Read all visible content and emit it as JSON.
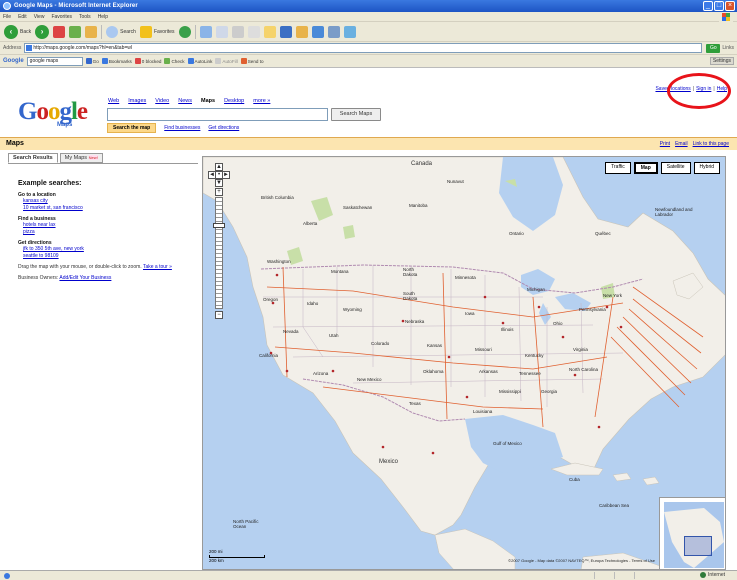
{
  "window": {
    "title": "Google Maps - Microsoft Internet Explorer"
  },
  "menubar": [
    "File",
    "Edit",
    "View",
    "Favorites",
    "Tools",
    "Help"
  ],
  "toolbar": {
    "back_label": "Back",
    "search_label": "Search",
    "favorites_label": "Favorites"
  },
  "address": {
    "label": "Address",
    "url": "http://maps.google.com/maps?hl=en&tab=wl",
    "go_label": "Go",
    "links_label": "Links"
  },
  "google_toolbar": {
    "brand": "Google",
    "query": "google maps",
    "items": [
      "Go",
      "Bookmarks",
      "0 blocked",
      "Check",
      "AutoLink",
      "AutoFill",
      "Send to",
      "Settings"
    ]
  },
  "header": {
    "links": [
      "Saved locations",
      "Sign in",
      "Help"
    ],
    "logo_letters": [
      "G",
      "o",
      "o",
      "g",
      "l",
      "e"
    ],
    "logo_sub": "Maps",
    "nav": [
      {
        "label": "Web",
        "active": false
      },
      {
        "label": "Images",
        "active": false
      },
      {
        "label": "Video",
        "active": false
      },
      {
        "label": "News",
        "active": false
      },
      {
        "label": "Maps",
        "active": true
      },
      {
        "label": "Desktop",
        "active": false
      },
      {
        "label": "more »",
        "active": false
      }
    ],
    "search_button": "Search Maps",
    "subtabs": [
      "Search the map",
      "Find businesses",
      "Get directions"
    ]
  },
  "maps_bar": {
    "title": "Maps",
    "actions": [
      "Print",
      "Email",
      "Link to this page"
    ]
  },
  "side": {
    "tabs": [
      "Search Results",
      "My Maps"
    ],
    "new_badge": "New!",
    "heading": "Example searches:",
    "sections": [
      {
        "title": "Go to a location",
        "links": [
          "kansas city",
          "10 market st, san francisco"
        ]
      },
      {
        "title": "Find a business",
        "links": [
          "hotels near lax",
          "pizza"
        ]
      },
      {
        "title": "Get directions",
        "links": [
          "jfk to 350 5th ave, new york",
          "seattle to 98109"
        ]
      }
    ],
    "drag_text": "Drag the map with your mouse, or double-click to zoom.",
    "tour_link": "Take a tour »",
    "owners_prefix": "Business Owners:",
    "owners_link": "Add/Edit Your Business"
  },
  "map": {
    "types": [
      {
        "label": "Traffic",
        "active": false
      },
      {
        "label": "Map",
        "active": true
      },
      {
        "label": "Satellite",
        "active": false
      },
      {
        "label": "Hybrid",
        "active": false
      }
    ],
    "scale": [
      "200 mi",
      "200 km"
    ],
    "copyright": "©2007 Google - Map data ©2007 NAVTEQ™, Europa Technologies - Terms of Use",
    "labels": {
      "canada": "Canada",
      "nunavut": "Nunavut",
      "bc": "British Columbia",
      "alberta": "Alberta",
      "saskatchewan": "Saskatchewan",
      "manitoba": "Manitoba",
      "ontario": "Ontario",
      "quebec": "Québec",
      "washington": "Washington",
      "oregon": "Oregon",
      "idaho": "Idaho",
      "montana": "Montana",
      "wyoming": "Wyoming",
      "north_dakota": "North Dakota",
      "south_dakota": "South Dakota",
      "minnesota": "Minnesota",
      "iowa": "Iowa",
      "nebraska": "Nebraska",
      "kansas": "Kansas",
      "missouri": "Missouri",
      "illinois": "Illinois",
      "colorado": "Colorado",
      "utah": "Utah",
      "nevada": "Nevada",
      "california": "California",
      "arizona": "Arizona",
      "new_mexico": "New Mexico",
      "texas": "Texas",
      "oklahoma": "Oklahoma",
      "arkansas": "Arkansas",
      "tennessee": "Tennessee",
      "kentucky": "Kentucky",
      "ohio": "Ohio",
      "pennsylvania": "Pennsylvania",
      "new_york": "New York",
      "virginia": "Virginia",
      "north_carolina": "North Carolina",
      "georgia": "Georgia",
      "mississippi": "Mississippi",
      "louisiana": "Louisiana",
      "michigan": "Michigan",
      "mexico": "Mexico",
      "gulf": "Gulf of Mexico",
      "cuba": "Cuba",
      "caribbean": "Caribbean Sea",
      "nfl": "Newfoundland and Labrador",
      "pacific": "North Pacific Ocean"
    }
  },
  "statusbar": {
    "zone": "Internet"
  },
  "colors": {
    "land": "#f2efe9",
    "water": "#b5d0f0",
    "park": "#c8dfa8",
    "border": "#b08ab0",
    "highway": "#e06030",
    "annotation": "#e8131a"
  }
}
